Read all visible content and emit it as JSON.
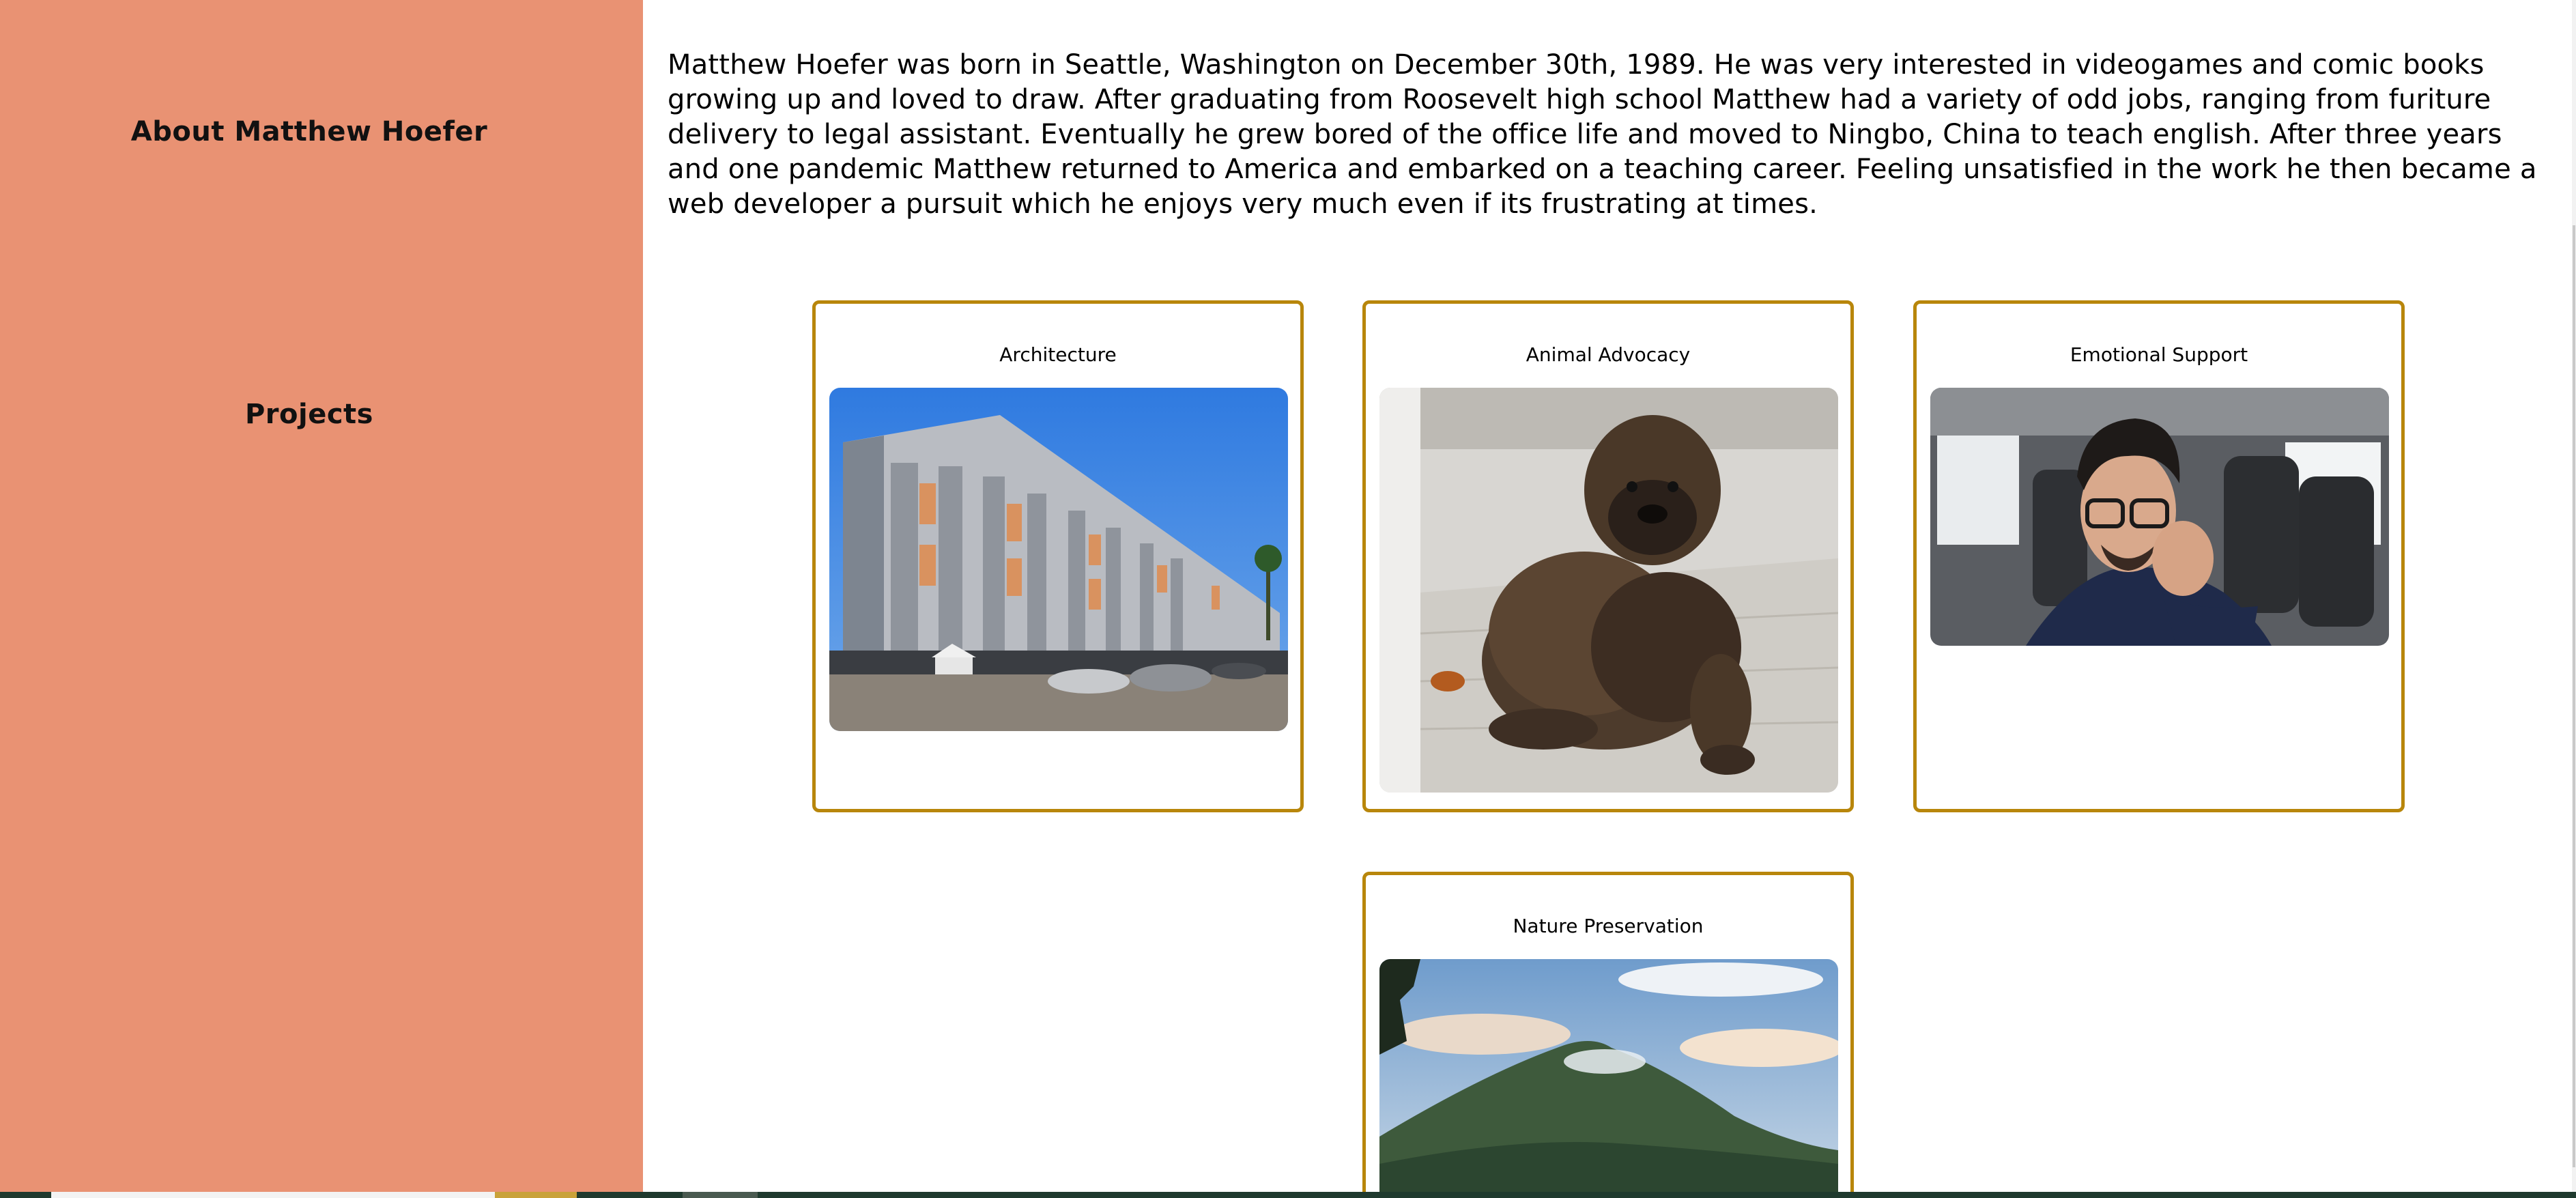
{
  "sidebar": {
    "about_label": "About Matthew Hoefer",
    "projects_label": "Projects"
  },
  "bio": {
    "text": "Matthew Hoefer was born in Seattle, Washington on December 30th, 1989. He was very interested in videogames and comic books growing up and loved to draw. After graduating from Roosevelt high school Matthew had a variety of odd jobs, ranging from furiture delivery to legal assistant. Eventually he grew bored of the office life and moved to Ningbo, China to teach english. After three years and one pandemic Matthew returned to America and embarked on a teaching career. Feeling unsatisfied in the work he then became a web developer a pursuit which he enjoys very much even if its frustrating at times."
  },
  "projects": [
    {
      "title": "Architecture"
    },
    {
      "title": "Animal Advocacy"
    },
    {
      "title": "Emotional Support"
    },
    {
      "title": "Nature Preservation"
    }
  ],
  "colors": {
    "sidebar_bg": "#e99273",
    "card_border": "#b8860b"
  }
}
